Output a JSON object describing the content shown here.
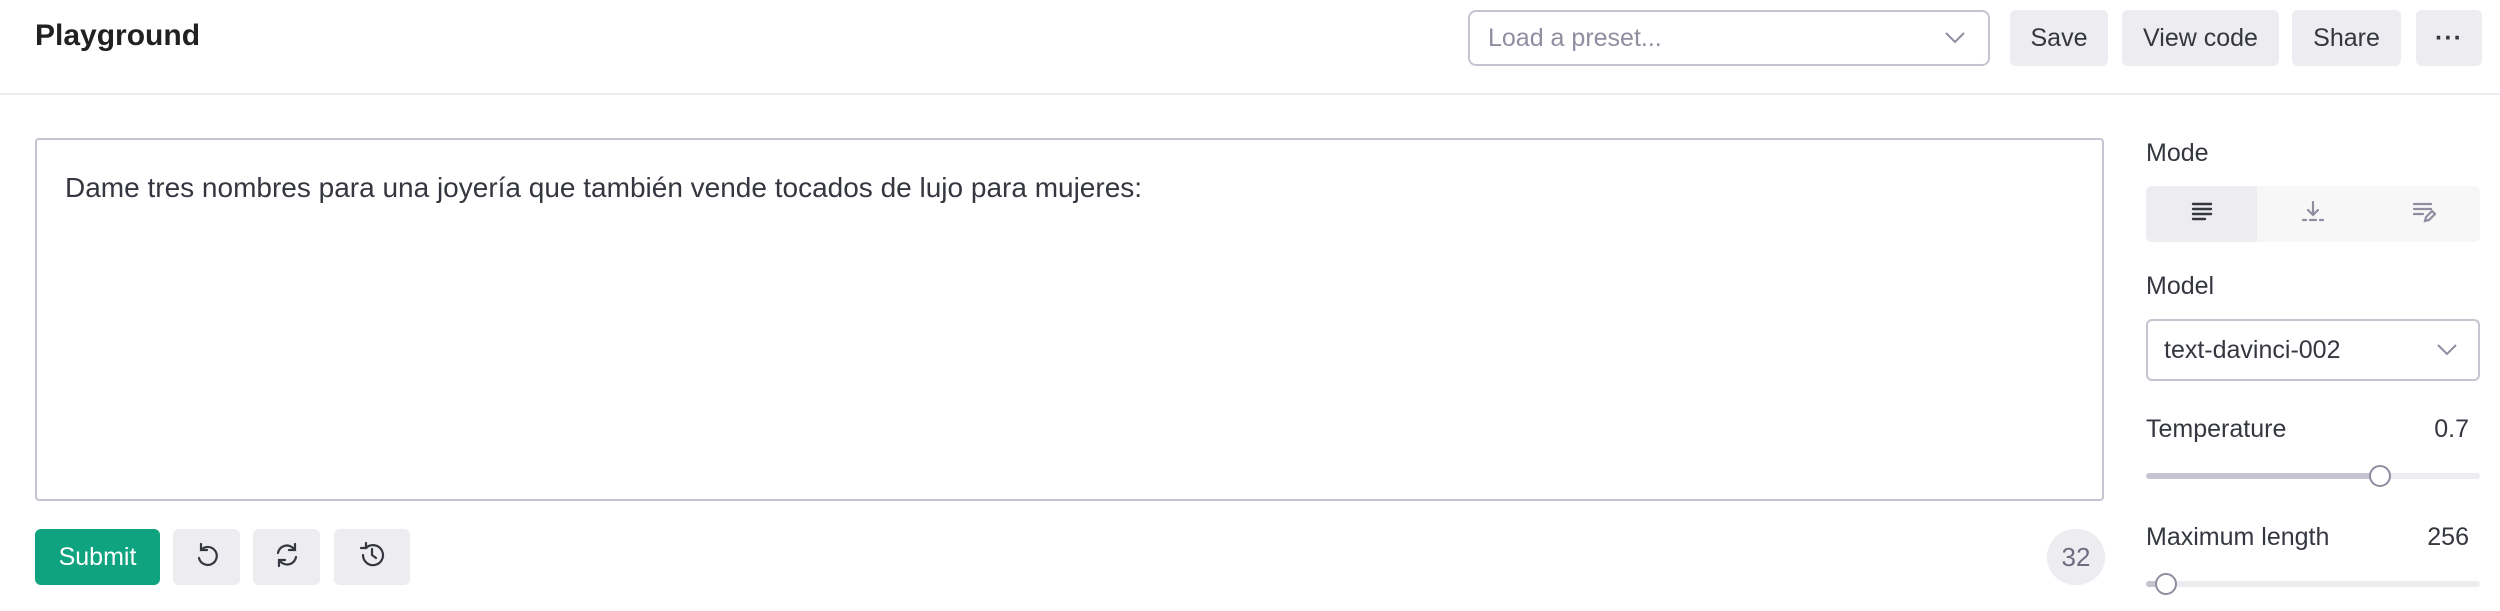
{
  "header": {
    "title": "Playground",
    "preset_placeholder": "Load a preset...",
    "save_label": "Save",
    "view_code_label": "View code",
    "share_label": "Share",
    "more_label": "···"
  },
  "editor": {
    "prompt_text": "Dame tres nombres para una joyería que también vende tocados de lujo para mujeres:"
  },
  "actions": {
    "submit_label": "Submit",
    "token_count": "32",
    "icons": [
      "undo-icon",
      "regenerate-icon",
      "history-icon"
    ]
  },
  "sidebar": {
    "mode_label": "Mode",
    "modes": [
      "complete-mode-icon",
      "insert-mode-icon",
      "edit-mode-icon"
    ],
    "active_mode": 0,
    "model_label": "Model",
    "model_value": "text-davinci-002",
    "temperature_label": "Temperature",
    "temperature_value": "0.7",
    "temperature_fraction": 0.7,
    "max_length_label": "Maximum length",
    "max_length_value": "256",
    "max_length_fraction": 0.06
  },
  "colors": {
    "accent": "#10a37f",
    "button_bg": "#ececf1",
    "border": "#c5c5d2",
    "text": "#353740"
  }
}
